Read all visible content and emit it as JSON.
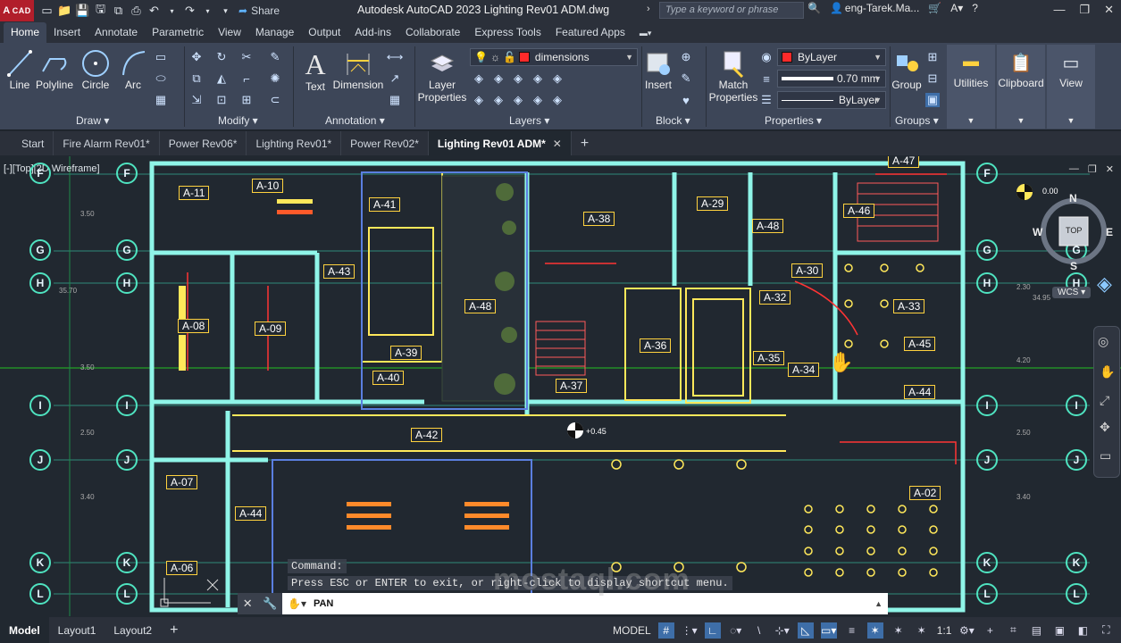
{
  "app": {
    "logo_text": "CAD",
    "title": "Autodesk AutoCAD 2023   Lighting Rev01 ADM.dwg",
    "share_label": "Share",
    "search_placeholder": "Type a keyword or phrase",
    "user": "eng-Tarek.Ma..."
  },
  "ribbon_tabs": [
    "Home",
    "Insert",
    "Annotate",
    "Parametric",
    "View",
    "Manage",
    "Output",
    "Add-ins",
    "Collaborate",
    "Express Tools",
    "Featured Apps"
  ],
  "active_ribbon_tab": "Home",
  "ribbon": {
    "draw": {
      "title": "Draw",
      "tools": [
        "Line",
        "Polyline",
        "Circle",
        "Arc"
      ]
    },
    "modify": {
      "title": "Modify"
    },
    "annotation": {
      "title": "Annotation",
      "tools": [
        "Text",
        "Dimension"
      ]
    },
    "layers": {
      "title": "Layers",
      "layer_props": "Layer\nProperties",
      "current_layer": "dimensions",
      "current_layer_color": "#ff2a2a"
    },
    "block": {
      "title": "Block",
      "insert": "Insert"
    },
    "properties": {
      "title": "Properties",
      "match": "Match\nProperties",
      "color": "ByLayer",
      "lineweight": "0.70 mm",
      "linetype": "ByLayer"
    },
    "groups": {
      "title": "Groups",
      "group": "Group"
    },
    "utilities": "Utilities",
    "clipboard": "Clipboard",
    "view": "View"
  },
  "file_tabs": [
    "Start",
    "Fire Alarm Rev01*",
    "Power Rev06*",
    "Lighting Rev01*",
    "Power Rev02*",
    "Lighting Rev01 ADM*"
  ],
  "active_file_tab": "Lighting Rev01 ADM*",
  "viewport_label": "[-][Top][2D Wireframe]",
  "grid_bubbles_left": [
    "F",
    "G",
    "H",
    "I",
    "J",
    "K",
    "L"
  ],
  "room_tags": [
    "A-11",
    "A-10",
    "A-41",
    "A-43",
    "A-48",
    "A-38",
    "A-29",
    "A-48",
    "A-46",
    "A-47",
    "A-08",
    "A-09",
    "A-39",
    "A-36",
    "A-32",
    "A-30",
    "A-33",
    "A-35",
    "A-34",
    "A-45",
    "A-44",
    "A-40",
    "A-37",
    "A-42",
    "A-07",
    "A-44",
    "A-06",
    "A-02"
  ],
  "dimensions": {
    "d1": "3.50",
    "d2": "35.70",
    "d3": "3.50",
    "d4": "2.50",
    "d5": "3.40",
    "d6": "34.95",
    "d7": "2.30",
    "d8": "4.20",
    "d9": "2.50",
    "d10": "3.40",
    "elev": "+0.45",
    "elev2": "0.00"
  },
  "viewcube": {
    "n": "N",
    "s": "S",
    "e": "E",
    "w": "W",
    "top": "TOP",
    "wcs": "WCS"
  },
  "command": {
    "history_1": "Command:",
    "history_2": "Press ESC or ENTER to exit, or right-click to display shortcut menu.",
    "current": "PAN"
  },
  "status_tabs": [
    "Model",
    "Layout1",
    "Layout2"
  ],
  "active_status_tab": "Model",
  "status": {
    "mode": "MODEL",
    "scale": "1:1"
  },
  "watermark": "mostaql.com"
}
